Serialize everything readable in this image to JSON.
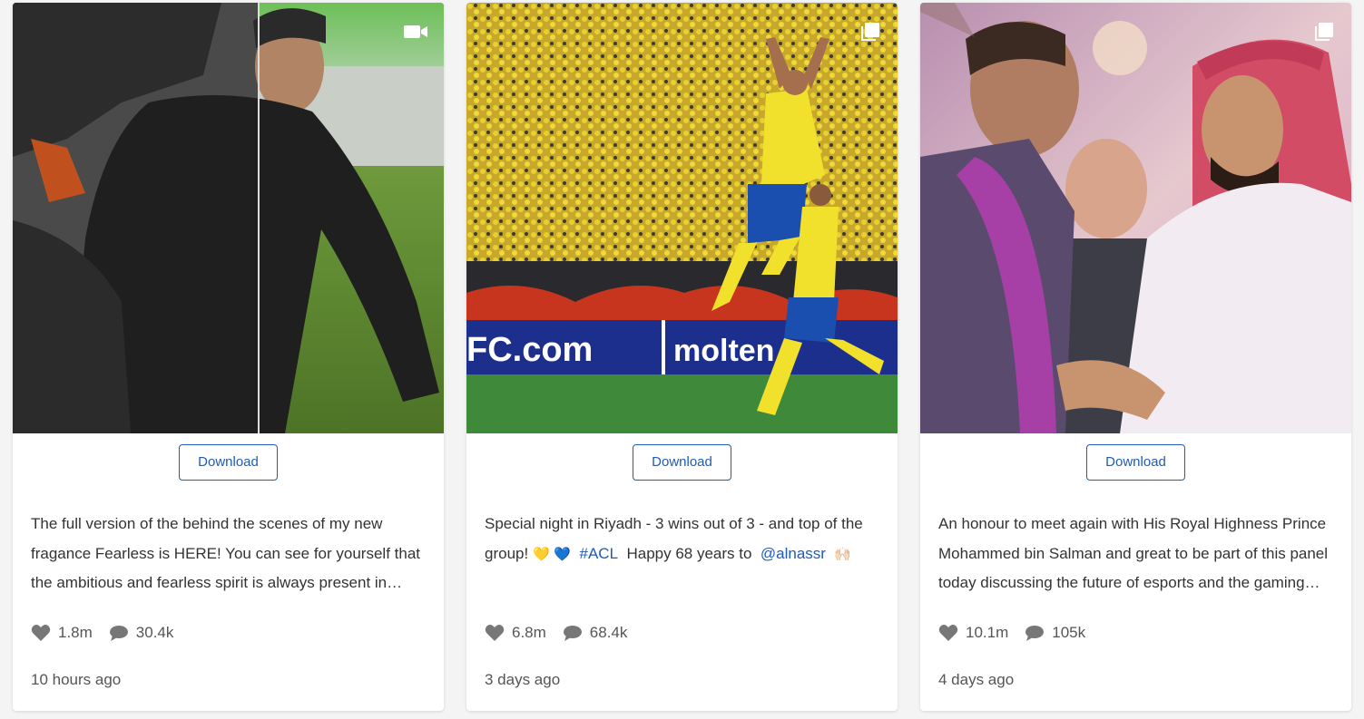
{
  "posts": [
    {
      "media_type_icon": "video-camera-icon",
      "image_description_icon": "person-in-black-on-grass-photo",
      "download_label": "Download",
      "caption": "The full version of the behind the scenes of my new fragance Fearless is HERE! You can see for yourself that the ambitious and fearless spirit is always present in everything I do",
      "likes": "1.8m",
      "comments": "30.4k",
      "time": "10 hours ago"
    },
    {
      "media_type_icon": "multiple-images-icon",
      "image_description_icon": "football-celebration-photo",
      "download_label": "Download",
      "caption_parts": {
        "text1": "Special night in Riyadh - 3 wins out of 3 - and top of the group!",
        "emoji1": "💛",
        "emoji2": "💙",
        "tag1": "#ACL",
        "text2": "Happy 68 years to",
        "tag2": "@alnassr",
        "emoji3": "🙌🏻"
      },
      "likes": "6.8m",
      "comments": "68.4k",
      "time": "3 days ago"
    },
    {
      "media_type_icon": "multiple-images-icon",
      "image_description_icon": "meeting-embrace-photo",
      "download_label": "Download",
      "caption": "An honour to meet again with His Royal Highness Prince Mohammed bin Salman and great to be part of this panel today discussing the future of esports and the gaming industry",
      "likes": "10.1m",
      "comments": "105k",
      "time": "4 days ago"
    }
  ],
  "colors": {
    "accent": "#1f5bb8",
    "text": "#333333",
    "muted": "#555555",
    "icon": "#777777"
  }
}
